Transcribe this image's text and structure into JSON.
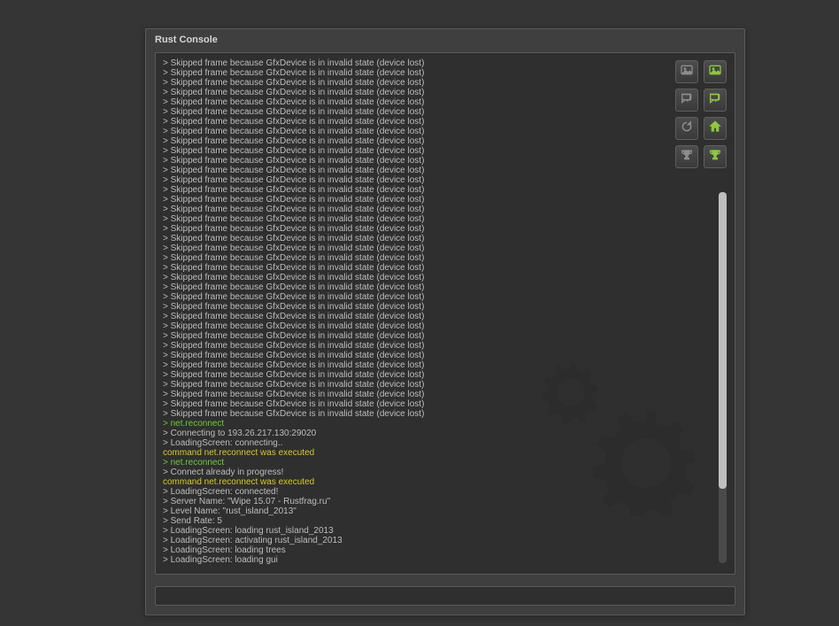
{
  "window": {
    "title": "Rust Console"
  },
  "colors": {
    "accent": "#8fc740"
  },
  "input": {
    "value": ""
  },
  "toolbar": {
    "items": [
      {
        "name": "screenshot-dark",
        "icon": "image",
        "style": "dark"
      },
      {
        "name": "screenshot",
        "icon": "image",
        "style": "accent"
      },
      {
        "name": "chat-dark",
        "icon": "chat",
        "style": "dark"
      },
      {
        "name": "chat",
        "icon": "chat",
        "style": "accent"
      },
      {
        "name": "refresh",
        "icon": "refresh",
        "style": "dark"
      },
      {
        "name": "home",
        "icon": "home",
        "style": "accent"
      },
      {
        "name": "trophy-dark",
        "icon": "trophy",
        "style": "dark"
      },
      {
        "name": "trophy",
        "icon": "trophy",
        "style": "accent"
      }
    ]
  },
  "log": [
    {
      "c": "default",
      "t": "> Skipped frame because GfxDevice is in invalid state (device lost)"
    },
    {
      "c": "default",
      "t": "> Skipped frame because GfxDevice is in invalid state (device lost)"
    },
    {
      "c": "default",
      "t": "> Skipped frame because GfxDevice is in invalid state (device lost)"
    },
    {
      "c": "default",
      "t": "> Skipped frame because GfxDevice is in invalid state (device lost)"
    },
    {
      "c": "default",
      "t": "> Skipped frame because GfxDevice is in invalid state (device lost)"
    },
    {
      "c": "default",
      "t": "> Skipped frame because GfxDevice is in invalid state (device lost)"
    },
    {
      "c": "default",
      "t": "> Skipped frame because GfxDevice is in invalid state (device lost)"
    },
    {
      "c": "default",
      "t": "> Skipped frame because GfxDevice is in invalid state (device lost)"
    },
    {
      "c": "default",
      "t": "> Skipped frame because GfxDevice is in invalid state (device lost)"
    },
    {
      "c": "default",
      "t": "> Skipped frame because GfxDevice is in invalid state (device lost)"
    },
    {
      "c": "default",
      "t": "> Skipped frame because GfxDevice is in invalid state (device lost)"
    },
    {
      "c": "default",
      "t": "> Skipped frame because GfxDevice is in invalid state (device lost)"
    },
    {
      "c": "default",
      "t": "> Skipped frame because GfxDevice is in invalid state (device lost)"
    },
    {
      "c": "default",
      "t": "> Skipped frame because GfxDevice is in invalid state (device lost)"
    },
    {
      "c": "default",
      "t": "> Skipped frame because GfxDevice is in invalid state (device lost)"
    },
    {
      "c": "default",
      "t": "> Skipped frame because GfxDevice is in invalid state (device lost)"
    },
    {
      "c": "default",
      "t": "> Skipped frame because GfxDevice is in invalid state (device lost)"
    },
    {
      "c": "default",
      "t": "> Skipped frame because GfxDevice is in invalid state (device lost)"
    },
    {
      "c": "default",
      "t": "> Skipped frame because GfxDevice is in invalid state (device lost)"
    },
    {
      "c": "default",
      "t": "> Skipped frame because GfxDevice is in invalid state (device lost)"
    },
    {
      "c": "default",
      "t": "> Skipped frame because GfxDevice is in invalid state (device lost)"
    },
    {
      "c": "default",
      "t": "> Skipped frame because GfxDevice is in invalid state (device lost)"
    },
    {
      "c": "default",
      "t": "> Skipped frame because GfxDevice is in invalid state (device lost)"
    },
    {
      "c": "default",
      "t": "> Skipped frame because GfxDevice is in invalid state (device lost)"
    },
    {
      "c": "default",
      "t": "> Skipped frame because GfxDevice is in invalid state (device lost)"
    },
    {
      "c": "default",
      "t": "> Skipped frame because GfxDevice is in invalid state (device lost)"
    },
    {
      "c": "default",
      "t": "> Skipped frame because GfxDevice is in invalid state (device lost)"
    },
    {
      "c": "default",
      "t": "> Skipped frame because GfxDevice is in invalid state (device lost)"
    },
    {
      "c": "default",
      "t": "> Skipped frame because GfxDevice is in invalid state (device lost)"
    },
    {
      "c": "default",
      "t": "> Skipped frame because GfxDevice is in invalid state (device lost)"
    },
    {
      "c": "default",
      "t": "> Skipped frame because GfxDevice is in invalid state (device lost)"
    },
    {
      "c": "default",
      "t": "> Skipped frame because GfxDevice is in invalid state (device lost)"
    },
    {
      "c": "default",
      "t": "> Skipped frame because GfxDevice is in invalid state (device lost)"
    },
    {
      "c": "default",
      "t": "> Skipped frame because GfxDevice is in invalid state (device lost)"
    },
    {
      "c": "default",
      "t": "> Skipped frame because GfxDevice is in invalid state (device lost)"
    },
    {
      "c": "default",
      "t": "> Skipped frame because GfxDevice is in invalid state (device lost)"
    },
    {
      "c": "default",
      "t": "> Skipped frame because GfxDevice is in invalid state (device lost)"
    },
    {
      "c": "green",
      "t": "> net.reconnect"
    },
    {
      "c": "default",
      "t": "> Connecting to 193.26.217.130:29020"
    },
    {
      "c": "default",
      "t": "> LoadingScreen: connecting.."
    },
    {
      "c": "yellow",
      "t": "command net.reconnect was executed"
    },
    {
      "c": "green",
      "t": "> net.reconnect"
    },
    {
      "c": "default",
      "t": "> Connect already in progress!"
    },
    {
      "c": "yellow",
      "t": "command net.reconnect was executed"
    },
    {
      "c": "default",
      "t": "> LoadingScreen: connected!"
    },
    {
      "c": "default",
      "t": "> Server Name: \"Wipe 15.07 - Rustfrag.ru\""
    },
    {
      "c": "default",
      "t": "> Level Name: \"rust_island_2013\""
    },
    {
      "c": "default",
      "t": "> Send Rate: 5"
    },
    {
      "c": "default",
      "t": "> LoadingScreen: loading rust_island_2013"
    },
    {
      "c": "default",
      "t": "> LoadingScreen: activating rust_island_2013"
    },
    {
      "c": "default",
      "t": "> LoadingScreen: loading trees"
    },
    {
      "c": "default",
      "t": "> LoadingScreen: loading gui"
    }
  ]
}
